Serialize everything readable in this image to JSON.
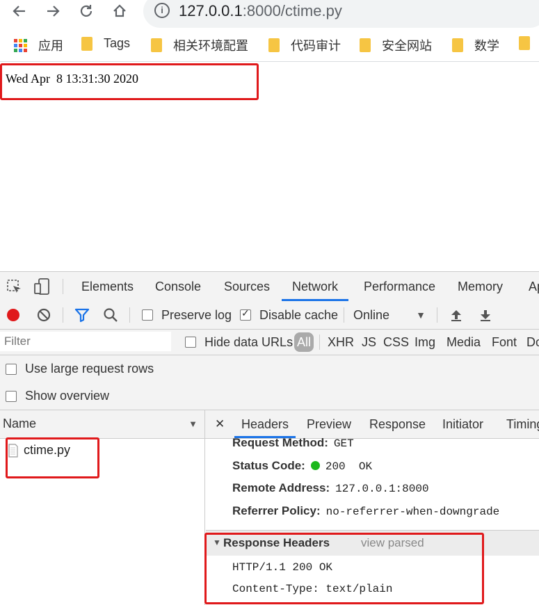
{
  "browser": {
    "url_host": "127.0.0.1",
    "url_rest": ":8000/ctime.py",
    "bookmarks": [
      {
        "label": "应用",
        "icon": "apps-grid-icon"
      },
      {
        "label": "Tags",
        "icon": "folder-icon"
      },
      {
        "label": "相关环境配置",
        "icon": "folder-icon"
      },
      {
        "label": "代码审计",
        "icon": "folder-icon"
      },
      {
        "label": "安全网站",
        "icon": "folder-icon"
      },
      {
        "label": "数学",
        "icon": "folder-icon"
      }
    ]
  },
  "page": {
    "time_text": "Wed Apr  8 13:31:30 2020"
  },
  "devtools": {
    "tabs": [
      "Elements",
      "Console",
      "Sources",
      "Network",
      "Performance",
      "Memory",
      "Ap"
    ],
    "active_tab": "Network",
    "toolbar": {
      "preserve_log": "Preserve log",
      "preserve_log_checked": false,
      "disable_cache": "Disable cache",
      "disable_cache_checked": true,
      "throttling": "Online"
    },
    "filter": {
      "placeholder": "Filter",
      "hide_data_urls": "Hide data URLs",
      "types": [
        "All",
        "XHR",
        "JS",
        "CSS",
        "Img",
        "Media",
        "Font",
        "Do"
      ],
      "active_type": "All"
    },
    "options": {
      "large_rows": "Use large request rows",
      "show_overview": "Show overview"
    },
    "name_column": {
      "header": "Name",
      "requests": [
        "ctime.py"
      ]
    },
    "detail_tabs": [
      "Headers",
      "Preview",
      "Response",
      "Initiator",
      "Timing"
    ],
    "active_detail_tab": "Headers",
    "general": [
      {
        "key": "Request Method:",
        "value": "GET"
      },
      {
        "key": "Status Code:",
        "value": "200  OK"
      },
      {
        "key": "Remote Address:",
        "value": "127.0.0.1:8000"
      },
      {
        "key": "Referrer Policy:",
        "value": "no-referrer-when-downgrade"
      }
    ],
    "response_headers": {
      "title": "Response Headers",
      "view_parsed": "view parsed",
      "lines": [
        "HTTP/1.1 200 OK",
        "Content-Type: text/plain"
      ]
    },
    "colors": {
      "highlight_box": "#e0191b",
      "active_tab_underline": "#1a73e8",
      "record_button": "#e0191b",
      "status_ok": "#1bb81b"
    }
  }
}
